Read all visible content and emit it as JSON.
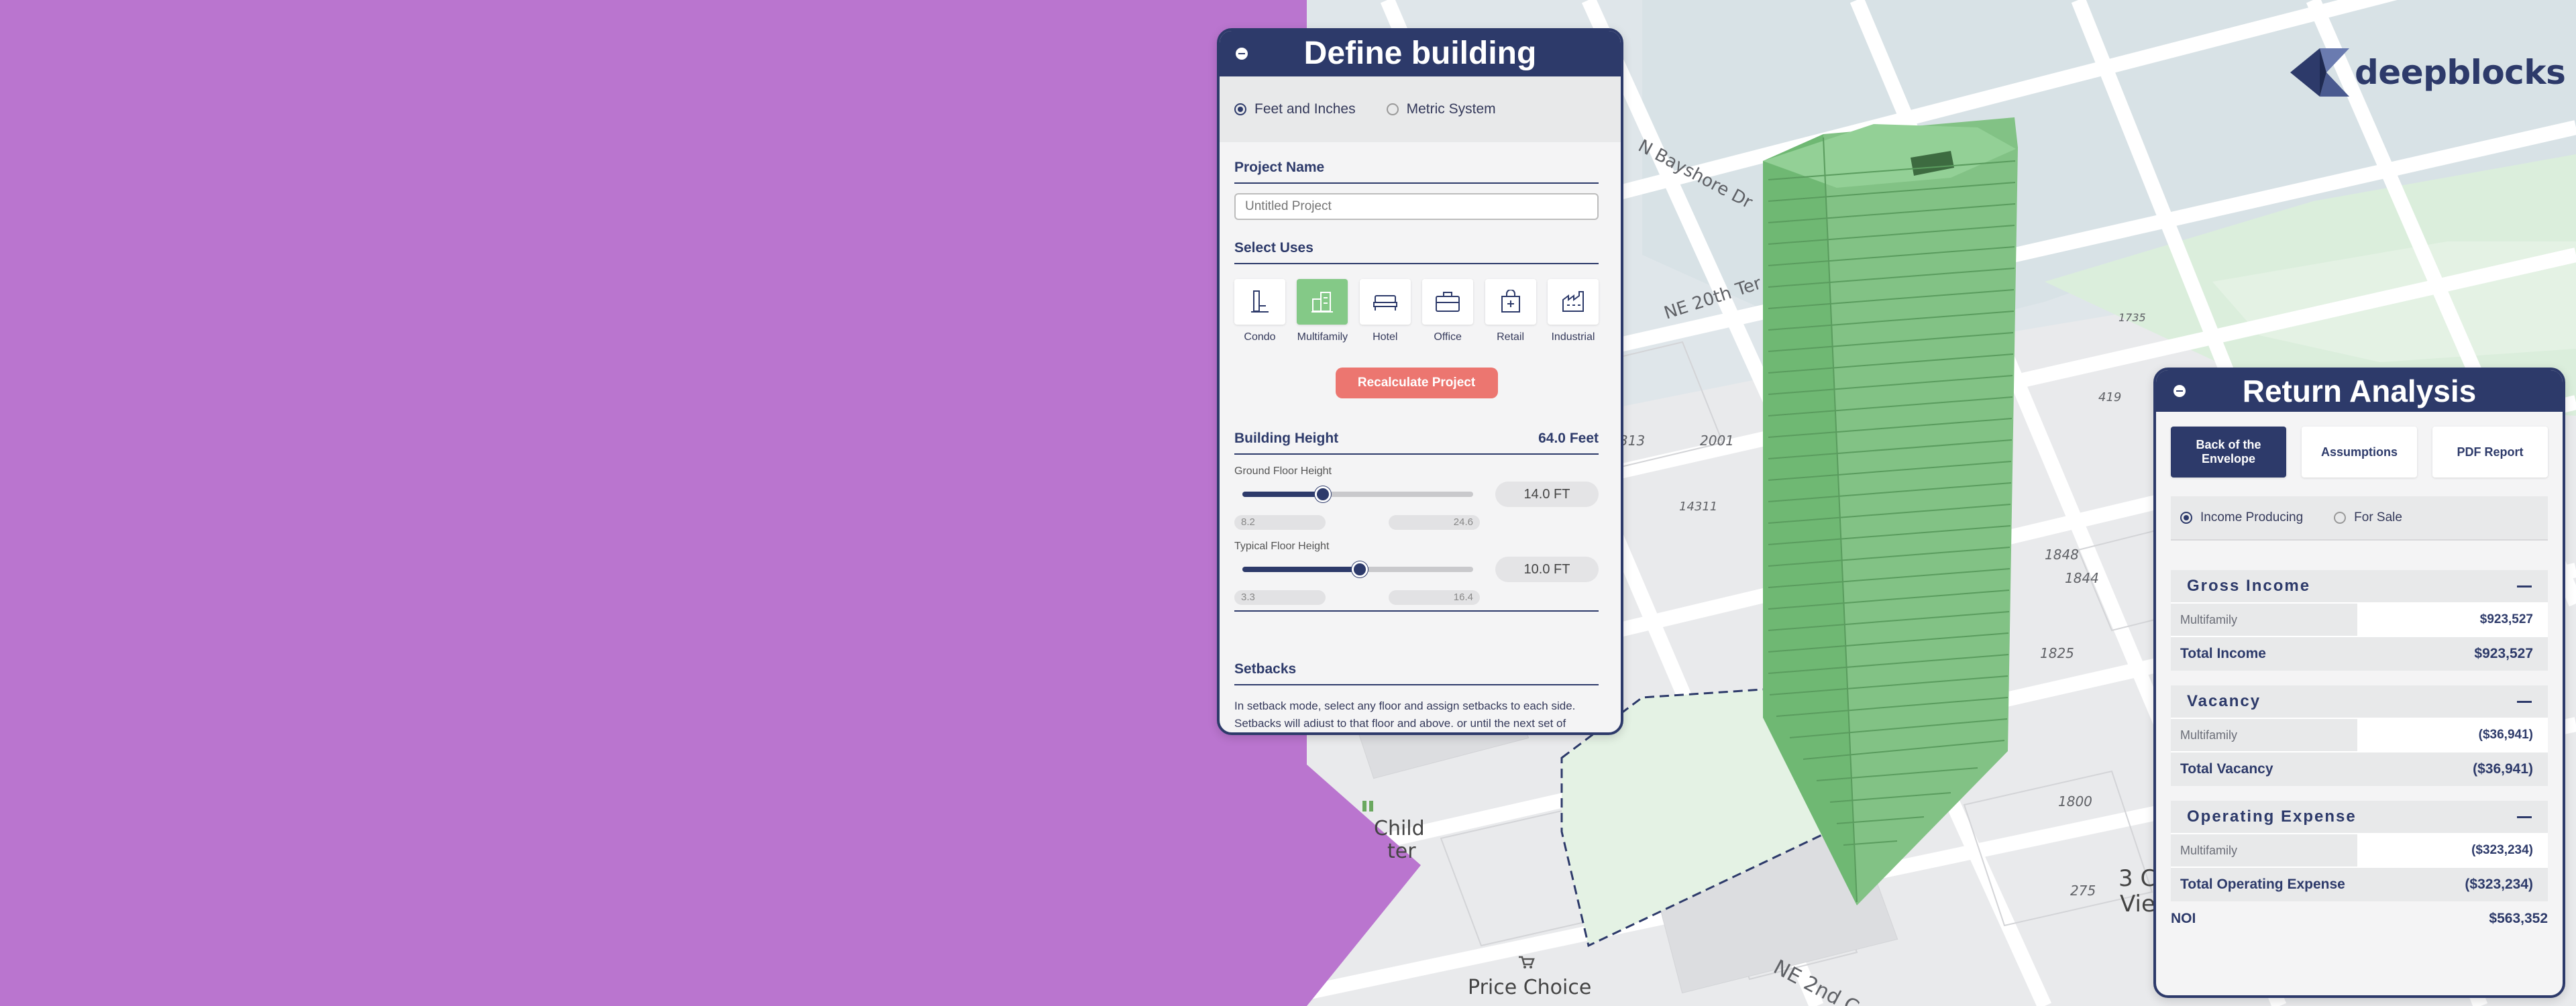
{
  "brand": {
    "name": "deepblocks"
  },
  "map": {
    "street_labels": [
      "N Bayshore Dr",
      "NE 20th Ter",
      "NE 2nd C"
    ],
    "numbers": [
      "2001",
      "14311",
      "1848",
      "1844",
      "1825",
      "1800",
      "275",
      "419",
      "1735",
      "313"
    ],
    "place_labels": [
      "Child",
      "ter",
      "Price Choice",
      "3 C",
      "Vie"
    ]
  },
  "define_panel": {
    "title": "Define building",
    "units": {
      "option1": "Feet and Inches",
      "option2": "Metric System",
      "selected": "Feet and Inches"
    },
    "project_name": {
      "title": "Project Name",
      "placeholder": "Untitled Project"
    },
    "select_uses": {
      "title": "Select Uses",
      "items": [
        {
          "label": "Condo",
          "icon": "condo-icon"
        },
        {
          "label": "Multifamily",
          "icon": "multifamily-icon",
          "selected": true
        },
        {
          "label": "Hotel",
          "icon": "hotel-icon"
        },
        {
          "label": "Office",
          "icon": "office-icon"
        },
        {
          "label": "Retail",
          "icon": "retail-icon"
        },
        {
          "label": "Industrial",
          "icon": "industrial-icon"
        }
      ]
    },
    "recalculate_label": "Recalculate Project",
    "building_height": {
      "title": "Building Height",
      "value": "64.0 Feet"
    },
    "ground_floor": {
      "label": "Ground Floor Height",
      "value": "14.0 FT",
      "min": "8.2",
      "max": "24.6",
      "fraction": 0.35
    },
    "typical_floor": {
      "label": "Typical Floor Height",
      "value": "10.0 FT",
      "min": "3.3",
      "max": "16.4",
      "fraction": 0.51
    },
    "setbacks": {
      "title": "Setbacks",
      "text1": "In setback mode, select any floor and assign setbacks to each side.",
      "text2": "Setbacks will adjust to that floor and above, or until the next set of"
    }
  },
  "return_panel": {
    "title": "Return Analysis",
    "tabs": [
      {
        "line1": "Back of the",
        "line2": "Envelope",
        "selected": true
      },
      {
        "line1": "Assumptions",
        "line2": ""
      },
      {
        "line1": "PDF Report",
        "line2": ""
      }
    ],
    "modes": {
      "option1": "Income Producing",
      "option2": "For Sale",
      "selected": "Income Producing"
    },
    "gross_income": {
      "title": "Gross Income",
      "row_label": "Multifamily",
      "row_value": "$923,527",
      "total_label": "Total Income",
      "total_value": "$923,527"
    },
    "vacancy": {
      "title": "Vacancy",
      "row_label": "Multifamily",
      "row_value": "($36,941)",
      "total_label": "Total Vacancy",
      "total_value": "($36,941)"
    },
    "operating_expense": {
      "title": "Operating Expense",
      "row_label": "Multifamily",
      "row_value": "($323,234)",
      "total_label": "Total Operating Expense",
      "total_value": "($323,234)"
    },
    "noi": {
      "label": "NOI",
      "value": "$563,352"
    }
  },
  "colors": {
    "navy": "#2d3a6a",
    "purple": "#ba75cf",
    "green": "#84c987",
    "coral": "#ec7670"
  }
}
